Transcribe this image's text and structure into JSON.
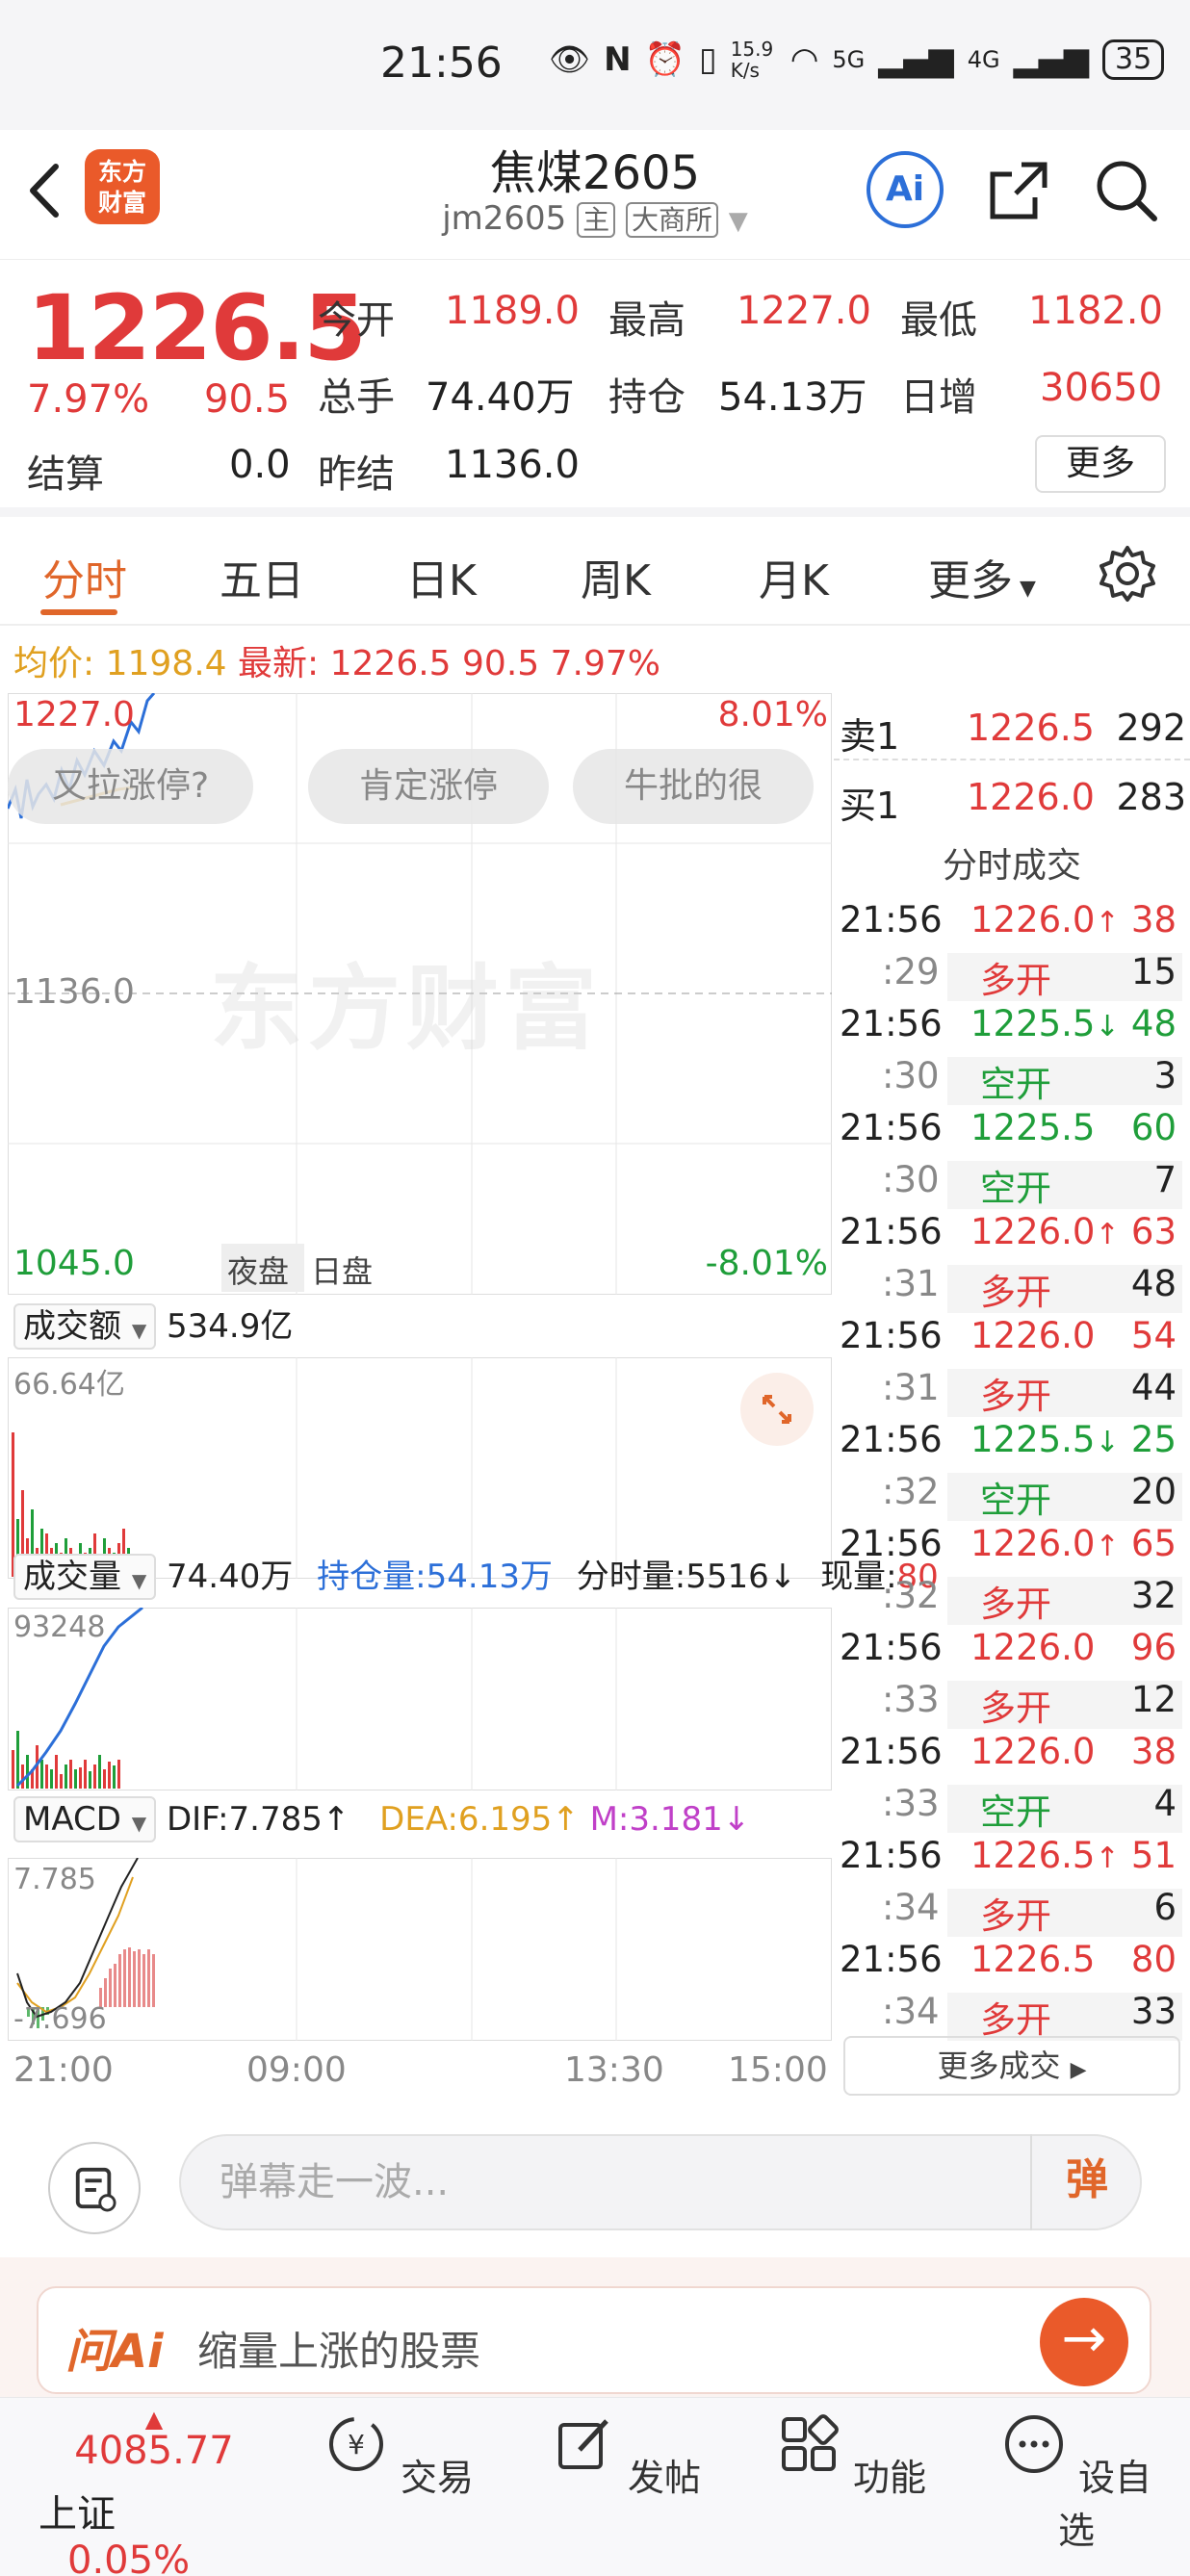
{
  "status_bar": {
    "time": "21:56",
    "net_speed": "15.9 K/s",
    "network_5g": "5G",
    "network_4g": "4G",
    "battery": "35"
  },
  "header": {
    "logo_text": "东方财富",
    "title": "焦煤2605",
    "code": "jm2605",
    "tag_main": "主",
    "tag_exchange": "大商所",
    "ai_label": "Ai"
  },
  "quote": {
    "price": "1226.5",
    "change_pct": "7.97%",
    "change_amt": "90.5",
    "open_label": "今开",
    "open": "1189.0",
    "high_label": "最高",
    "high": "1227.0",
    "low_label": "最低",
    "low": "1182.0",
    "volume_label": "总手",
    "volume": "74.40万",
    "oi_label": "持仓",
    "oi": "54.13万",
    "daily_inc_label": "日增",
    "daily_inc": "30650",
    "settle_label": "结算",
    "settle": "0.0",
    "prev_settle_label": "昨结",
    "prev_settle": "1136.0",
    "more_label": "更多"
  },
  "tabs": [
    "分时",
    "五日",
    "日K",
    "周K",
    "月K",
    "更多"
  ],
  "avg_line": {
    "avg_label": "均价:",
    "avg": "1198.4",
    "latest_label": "最新:",
    "latest": "1226.5",
    "chg": "90.5",
    "pct": "7.97%"
  },
  "chart": {
    "top_price": "1227.0",
    "top_pct": "8.01%",
    "mid_price": "1136.0",
    "bottom_price": "1045.0",
    "bottom_pct": "-8.01%",
    "session_night": "夜盘",
    "session_day": "日盘",
    "watermark": "东方财富",
    "danmu": [
      "又拉涨停?",
      "肯定涨停",
      "牛批的很"
    ],
    "turnover_label": "成交额",
    "turnover": "534.9亿",
    "turnover_max": "66.64亿",
    "volume_label": "成交量",
    "volume": "74.40万",
    "oi_text": "持仓量:54.13万",
    "tick_vol_text": "分时量:5516↓",
    "cur_vol_label": "现量:",
    "cur_vol": "80",
    "volume_max": "93248",
    "macd_label": "MACD",
    "dif": "DIF:7.785↑",
    "dea": "DEA:6.195↑",
    "m": "M:3.181↓",
    "macd_top": "7.785",
    "macd_bottom": "-7.696",
    "time_labels": [
      "21:00",
      "09:00",
      "13:30",
      "15:00"
    ]
  },
  "order_book": {
    "ask_label": "卖1",
    "ask_price": "1226.5",
    "ask_vol": "292",
    "bid_label": "买1",
    "bid_price": "1226.0",
    "bid_vol": "283",
    "trades_title": "分时成交",
    "more_trades": "更多成交"
  },
  "trades": [
    {
      "time": "21:56",
      "price": "1226.0",
      "arrow": "↑",
      "vol": "38",
      "color": "red",
      "sub_time": ":29",
      "type": "多开",
      "type_color": "red",
      "sub_vol": "15"
    },
    {
      "time": "21:56",
      "price": "1225.5",
      "arrow": "↓",
      "vol": "48",
      "color": "green",
      "sub_time": ":30",
      "type": "空开",
      "type_color": "green",
      "sub_vol": "3"
    },
    {
      "time": "21:56",
      "price": "1225.5",
      "arrow": "",
      "vol": "60",
      "color": "green",
      "sub_time": ":30",
      "type": "空开",
      "type_color": "green",
      "sub_vol": "7"
    },
    {
      "time": "21:56",
      "price": "1226.0",
      "arrow": "↑",
      "vol": "63",
      "color": "red",
      "sub_time": ":31",
      "type": "多开",
      "type_color": "red",
      "sub_vol": "48"
    },
    {
      "time": "21:56",
      "price": "1226.0",
      "arrow": "",
      "vol": "54",
      "color": "red",
      "sub_time": ":31",
      "type": "多开",
      "type_color": "red",
      "sub_vol": "44"
    },
    {
      "time": "21:56",
      "price": "1225.5",
      "arrow": "↓",
      "vol": "25",
      "color": "green",
      "sub_time": ":32",
      "type": "空开",
      "type_color": "green",
      "sub_vol": "20"
    },
    {
      "time": "21:56",
      "price": "1226.0",
      "arrow": "↑",
      "vol": "65",
      "color": "red",
      "sub_time": ":32",
      "type": "多开",
      "type_color": "red",
      "sub_vol": "32"
    },
    {
      "time": "21:56",
      "price": "1226.0",
      "arrow": "",
      "vol": "96",
      "color": "red",
      "sub_time": ":33",
      "type": "多开",
      "type_color": "red",
      "sub_vol": "12"
    },
    {
      "time": "21:56",
      "price": "1226.0",
      "arrow": "",
      "vol": "38",
      "color": "red",
      "sub_time": ":33",
      "type": "空开",
      "type_color": "green",
      "sub_vol": "4"
    },
    {
      "time": "21:56",
      "price": "1226.5",
      "arrow": "↑",
      "vol": "51",
      "color": "red",
      "sub_time": ":34",
      "type": "多开",
      "type_color": "red",
      "sub_vol": "6"
    },
    {
      "time": "21:56",
      "price": "1226.5",
      "arrow": "",
      "vol": "80",
      "color": "red",
      "sub_time": ":34",
      "type": "多开",
      "type_color": "red",
      "sub_vol": "33"
    }
  ],
  "comment": {
    "placeholder": "弹幕走一波...",
    "send_label": "弹"
  },
  "ask_ai": {
    "brand": "问Ai",
    "prompt": "缩量上涨的股票"
  },
  "bottom_nav": {
    "index_value": "4085.77",
    "index_name": "上证",
    "index_pct": "0.05%",
    "items": [
      "交易",
      "发帖",
      "功能",
      "设自选"
    ]
  },
  "colors": {
    "up": "#e03a3a",
    "down": "#1f9e3a",
    "accent": "#e0662a",
    "ai_blue": "#2c6fd8"
  }
}
